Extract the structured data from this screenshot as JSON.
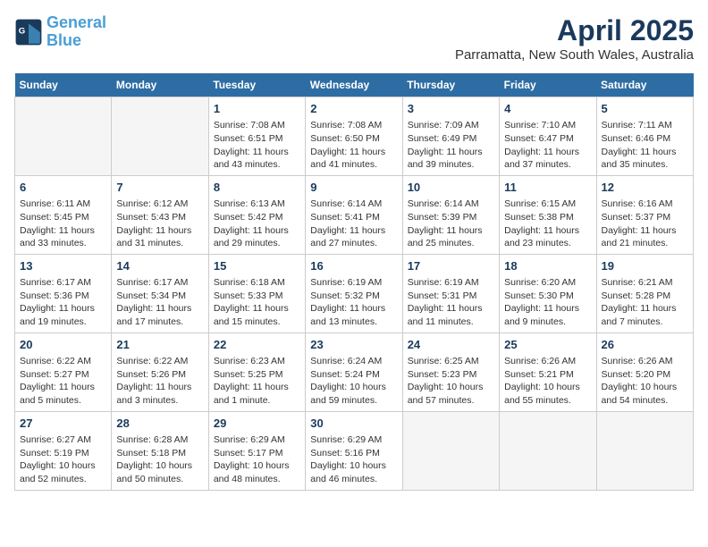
{
  "header": {
    "logo_line1": "General",
    "logo_line2": "Blue",
    "title": "April 2025",
    "subtitle": "Parramatta, New South Wales, Australia"
  },
  "days_of_week": [
    "Sunday",
    "Monday",
    "Tuesday",
    "Wednesday",
    "Thursday",
    "Friday",
    "Saturday"
  ],
  "weeks": [
    [
      {
        "day": "",
        "empty": true
      },
      {
        "day": "",
        "empty": true
      },
      {
        "day": "1",
        "sunrise": "Sunrise: 7:08 AM",
        "sunset": "Sunset: 6:51 PM",
        "daylight": "Daylight: 11 hours and 43 minutes."
      },
      {
        "day": "2",
        "sunrise": "Sunrise: 7:08 AM",
        "sunset": "Sunset: 6:50 PM",
        "daylight": "Daylight: 11 hours and 41 minutes."
      },
      {
        "day": "3",
        "sunrise": "Sunrise: 7:09 AM",
        "sunset": "Sunset: 6:49 PM",
        "daylight": "Daylight: 11 hours and 39 minutes."
      },
      {
        "day": "4",
        "sunrise": "Sunrise: 7:10 AM",
        "sunset": "Sunset: 6:47 PM",
        "daylight": "Daylight: 11 hours and 37 minutes."
      },
      {
        "day": "5",
        "sunrise": "Sunrise: 7:11 AM",
        "sunset": "Sunset: 6:46 PM",
        "daylight": "Daylight: 11 hours and 35 minutes."
      }
    ],
    [
      {
        "day": "6",
        "sunrise": "Sunrise: 6:11 AM",
        "sunset": "Sunset: 5:45 PM",
        "daylight": "Daylight: 11 hours and 33 minutes."
      },
      {
        "day": "7",
        "sunrise": "Sunrise: 6:12 AM",
        "sunset": "Sunset: 5:43 PM",
        "daylight": "Daylight: 11 hours and 31 minutes."
      },
      {
        "day": "8",
        "sunrise": "Sunrise: 6:13 AM",
        "sunset": "Sunset: 5:42 PM",
        "daylight": "Daylight: 11 hours and 29 minutes."
      },
      {
        "day": "9",
        "sunrise": "Sunrise: 6:14 AM",
        "sunset": "Sunset: 5:41 PM",
        "daylight": "Daylight: 11 hours and 27 minutes."
      },
      {
        "day": "10",
        "sunrise": "Sunrise: 6:14 AM",
        "sunset": "Sunset: 5:39 PM",
        "daylight": "Daylight: 11 hours and 25 minutes."
      },
      {
        "day": "11",
        "sunrise": "Sunrise: 6:15 AM",
        "sunset": "Sunset: 5:38 PM",
        "daylight": "Daylight: 11 hours and 23 minutes."
      },
      {
        "day": "12",
        "sunrise": "Sunrise: 6:16 AM",
        "sunset": "Sunset: 5:37 PM",
        "daylight": "Daylight: 11 hours and 21 minutes."
      }
    ],
    [
      {
        "day": "13",
        "sunrise": "Sunrise: 6:17 AM",
        "sunset": "Sunset: 5:36 PM",
        "daylight": "Daylight: 11 hours and 19 minutes."
      },
      {
        "day": "14",
        "sunrise": "Sunrise: 6:17 AM",
        "sunset": "Sunset: 5:34 PM",
        "daylight": "Daylight: 11 hours and 17 minutes."
      },
      {
        "day": "15",
        "sunrise": "Sunrise: 6:18 AM",
        "sunset": "Sunset: 5:33 PM",
        "daylight": "Daylight: 11 hours and 15 minutes."
      },
      {
        "day": "16",
        "sunrise": "Sunrise: 6:19 AM",
        "sunset": "Sunset: 5:32 PM",
        "daylight": "Daylight: 11 hours and 13 minutes."
      },
      {
        "day": "17",
        "sunrise": "Sunrise: 6:19 AM",
        "sunset": "Sunset: 5:31 PM",
        "daylight": "Daylight: 11 hours and 11 minutes."
      },
      {
        "day": "18",
        "sunrise": "Sunrise: 6:20 AM",
        "sunset": "Sunset: 5:30 PM",
        "daylight": "Daylight: 11 hours and 9 minutes."
      },
      {
        "day": "19",
        "sunrise": "Sunrise: 6:21 AM",
        "sunset": "Sunset: 5:28 PM",
        "daylight": "Daylight: 11 hours and 7 minutes."
      }
    ],
    [
      {
        "day": "20",
        "sunrise": "Sunrise: 6:22 AM",
        "sunset": "Sunset: 5:27 PM",
        "daylight": "Daylight: 11 hours and 5 minutes."
      },
      {
        "day": "21",
        "sunrise": "Sunrise: 6:22 AM",
        "sunset": "Sunset: 5:26 PM",
        "daylight": "Daylight: 11 hours and 3 minutes."
      },
      {
        "day": "22",
        "sunrise": "Sunrise: 6:23 AM",
        "sunset": "Sunset: 5:25 PM",
        "daylight": "Daylight: 11 hours and 1 minute."
      },
      {
        "day": "23",
        "sunrise": "Sunrise: 6:24 AM",
        "sunset": "Sunset: 5:24 PM",
        "daylight": "Daylight: 10 hours and 59 minutes."
      },
      {
        "day": "24",
        "sunrise": "Sunrise: 6:25 AM",
        "sunset": "Sunset: 5:23 PM",
        "daylight": "Daylight: 10 hours and 57 minutes."
      },
      {
        "day": "25",
        "sunrise": "Sunrise: 6:26 AM",
        "sunset": "Sunset: 5:21 PM",
        "daylight": "Daylight: 10 hours and 55 minutes."
      },
      {
        "day": "26",
        "sunrise": "Sunrise: 6:26 AM",
        "sunset": "Sunset: 5:20 PM",
        "daylight": "Daylight: 10 hours and 54 minutes."
      }
    ],
    [
      {
        "day": "27",
        "sunrise": "Sunrise: 6:27 AM",
        "sunset": "Sunset: 5:19 PM",
        "daylight": "Daylight: 10 hours and 52 minutes."
      },
      {
        "day": "28",
        "sunrise": "Sunrise: 6:28 AM",
        "sunset": "Sunset: 5:18 PM",
        "daylight": "Daylight: 10 hours and 50 minutes."
      },
      {
        "day": "29",
        "sunrise": "Sunrise: 6:29 AM",
        "sunset": "Sunset: 5:17 PM",
        "daylight": "Daylight: 10 hours and 48 minutes."
      },
      {
        "day": "30",
        "sunrise": "Sunrise: 6:29 AM",
        "sunset": "Sunset: 5:16 PM",
        "daylight": "Daylight: 10 hours and 46 minutes."
      },
      {
        "day": "",
        "empty": true
      },
      {
        "day": "",
        "empty": true
      },
      {
        "day": "",
        "empty": true
      }
    ]
  ]
}
